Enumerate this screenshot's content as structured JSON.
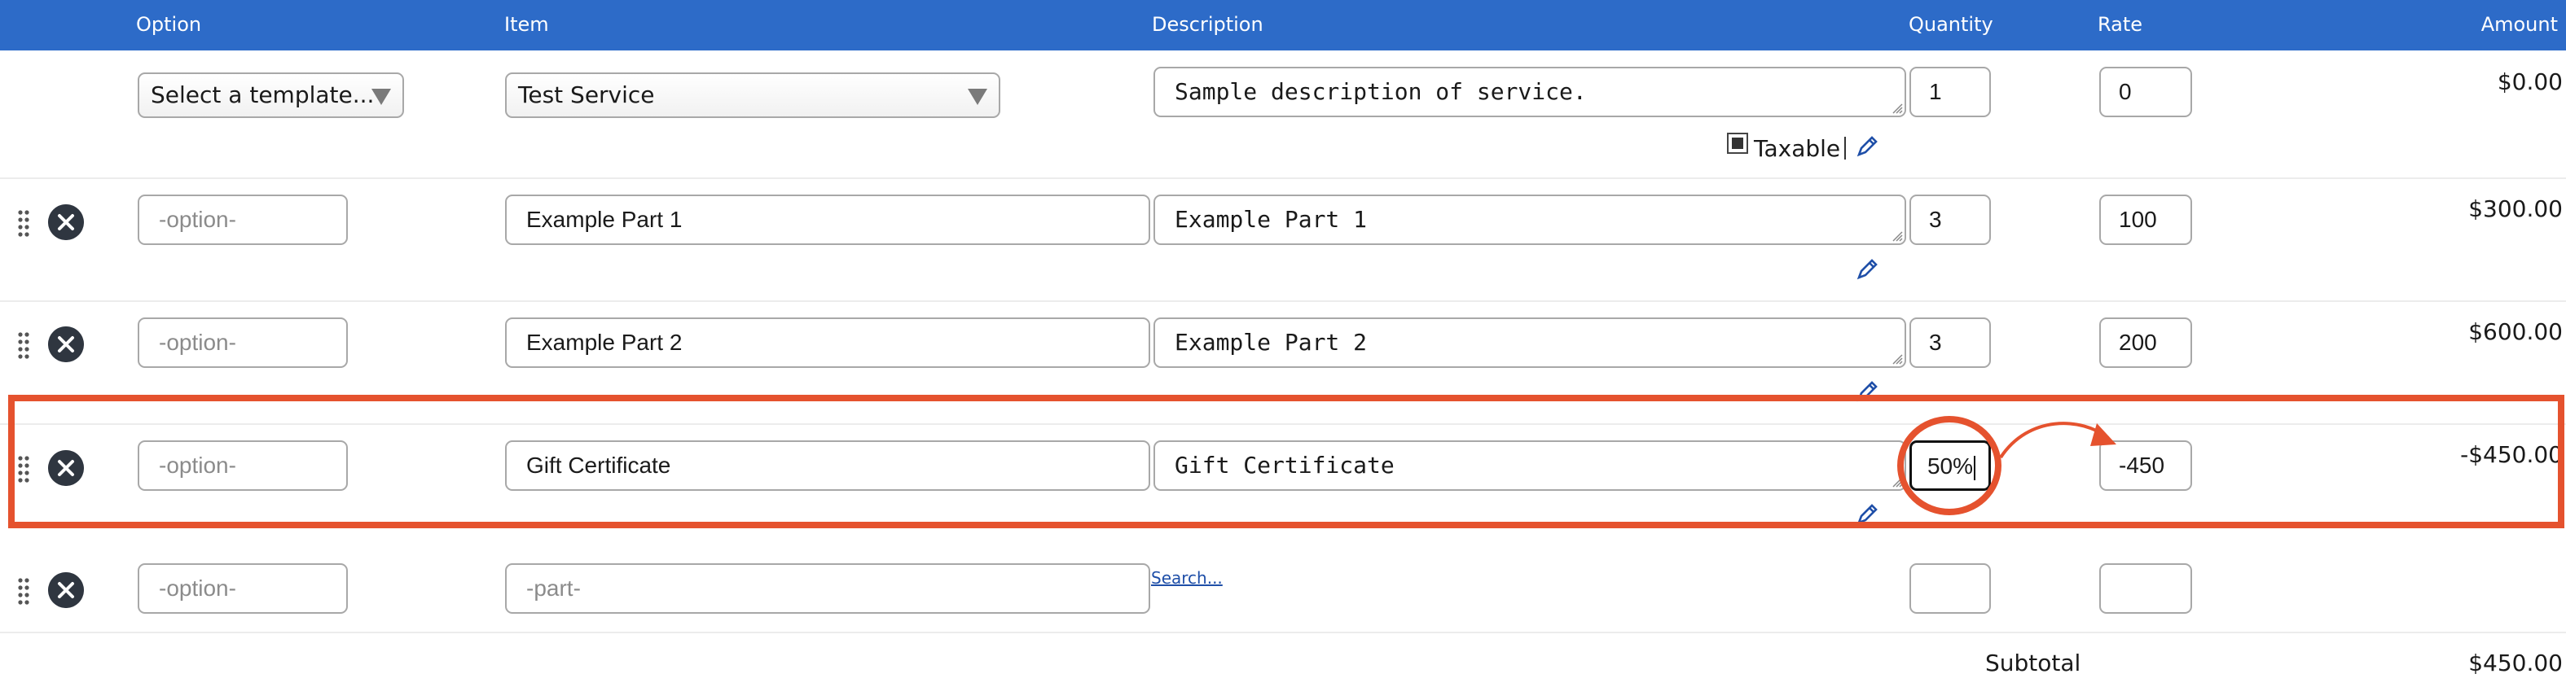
{
  "header": {
    "option": "Option",
    "item": "Item",
    "description": "Description",
    "quantity": "Quantity",
    "rate": "Rate",
    "amount": "Amount"
  },
  "template_row": {
    "template_select": "Select a template...",
    "item_select": "Test Service",
    "description": "Sample description of service.",
    "quantity": "1",
    "rate": "0",
    "amount": "$0.00",
    "taxable_label": "Taxable"
  },
  "rows": [
    {
      "option_placeholder": "-option-",
      "item": "Example Part 1",
      "description": "Example Part 1",
      "quantity": "3",
      "rate": "100",
      "amount": "$300.00"
    },
    {
      "option_placeholder": "-option-",
      "item": "Example Part 2",
      "description": "Example Part 2",
      "quantity": "3",
      "rate": "200",
      "amount": "$600.00"
    },
    {
      "option_placeholder": "-option-",
      "item": "Gift Certificate",
      "description": "Gift Certificate",
      "quantity": "50%",
      "rate": "-450",
      "amount": "-$450.00"
    }
  ],
  "empty_row": {
    "option_placeholder": "-option-",
    "part_placeholder": "-part-",
    "search_link": "Search..."
  },
  "subtotal": {
    "label": "Subtotal",
    "value": "$450.00"
  },
  "colors": {
    "header_bg": "#2d6bc8",
    "annotation": "#e5522e",
    "link": "#1f4fa8"
  }
}
